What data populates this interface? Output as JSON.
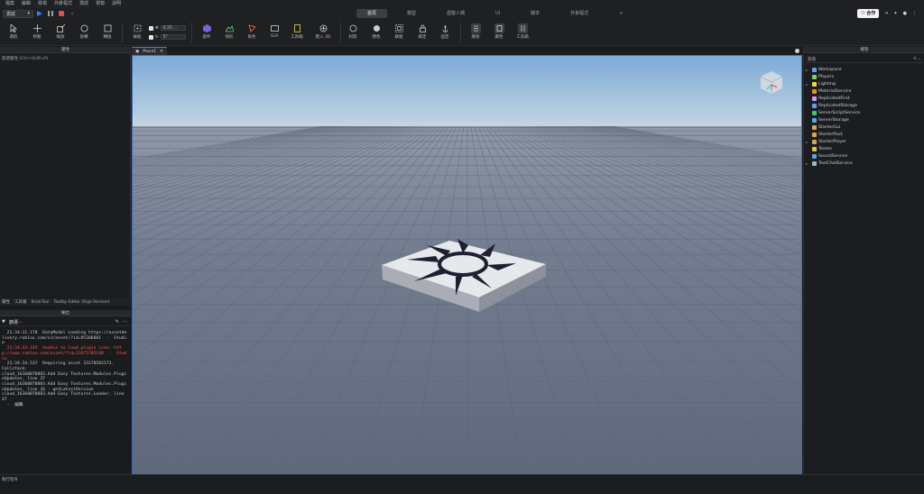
{
  "menu": [
    "檔案",
    "編輯",
    "檢視",
    "外掛程式",
    "測試",
    "視窗",
    "說明"
  ],
  "test_mode": "測試",
  "tabs": [
    {
      "label": "首頁",
      "active": true
    },
    {
      "label": "模型",
      "active": false
    },
    {
      "label": "虛擬人偶",
      "active": false
    },
    {
      "label": "UI",
      "active": false
    },
    {
      "label": "腳本",
      "active": false
    },
    {
      "label": "外掛程式",
      "active": false
    }
  ],
  "share_label": "合作",
  "toolbar": {
    "select": "選取",
    "move": "移動",
    "scale": "縮放",
    "rotate": "旋轉",
    "transform": "轉換",
    "pivot": "樞紐",
    "snap_move_value": "0.25 ...",
    "snap_rotate_value": "5°",
    "part": "部件",
    "terrain": "地形",
    "character": "角色",
    "gui": "GUI",
    "material_toolbox": "工具箱",
    "import3d": "匯入 3D",
    "material": "材質",
    "color": "顏色",
    "group": "群組",
    "lock": "鎖定",
    "anchor": "固定",
    "explorer": "總管",
    "properties": "屬性",
    "toolbox": "工具箱"
  },
  "left_panel": {
    "title": "屬性",
    "filter": "篩選屬性 (Ctrl+Shift+P)"
  },
  "bottom_tabs": [
    "屬性",
    "工具箱",
    "BrickTool",
    "Tooltip Editor (Rojo Version)"
  ],
  "output": {
    "title": "輸出",
    "filter": "篩選···",
    "lines": [
      {
        "text": "  21:34:31.178  DataModel Loading https://assetdelivery.roblox.com/v1/asset/?id=95206881  -  Studio",
        "error": false
      },
      {
        "text": "  21:34:33.145  Unable to load plugin icon: http://www.roblox.com/asset/?id=11675705140  -  Studio",
        "error": true
      },
      {
        "text": "  21:34:34.537  Requiring asset 13178582173.\nCallstack:\ncloud_16360078883.Add Easy Textures.Modules.PluginUpdates, line 37\ncloud_16360078883.Add Easy Textures.Modules.PluginUpdates, line 26 - getLatestVersion\ncloud_16360078883.Add Easy Textures.Loader, line 47\n  -  編輯",
        "error": false
      }
    ]
  },
  "viewport_tab": "Place1",
  "explorer": {
    "title": "總管",
    "filter": "篩選",
    "items": [
      {
        "label": "Workspace",
        "expandable": true,
        "color": "#5fa3e6"
      },
      {
        "label": "Players",
        "expandable": false,
        "color": "#7ccf6b"
      },
      {
        "label": "Lighting",
        "expandable": true,
        "color": "#f2d24b"
      },
      {
        "label": "MaterialService",
        "expandable": false,
        "color": "#e08a3c"
      },
      {
        "label": "ReplicatedFirst",
        "expandable": false,
        "color": "#c9a0e8"
      },
      {
        "label": "ReplicatedStorage",
        "expandable": false,
        "color": "#5fa3e6"
      },
      {
        "label": "ServerScriptService",
        "expandable": false,
        "color": "#4cc46b"
      },
      {
        "label": "ServerStorage",
        "expandable": false,
        "color": "#5fa3e6"
      },
      {
        "label": "StarterGui",
        "expandable": false,
        "color": "#d9a45a"
      },
      {
        "label": "StarterPack",
        "expandable": false,
        "color": "#d9a45a"
      },
      {
        "label": "StarterPlayer",
        "expandable": true,
        "color": "#d9a45a"
      },
      {
        "label": "Teams",
        "expandable": false,
        "color": "#e6c24b"
      },
      {
        "label": "SoundService",
        "expandable": false,
        "color": "#5fa3e6"
      },
      {
        "label": "TextChatService",
        "expandable": true,
        "color": "#9fb5cc"
      }
    ]
  },
  "command_bar": "執行指令"
}
